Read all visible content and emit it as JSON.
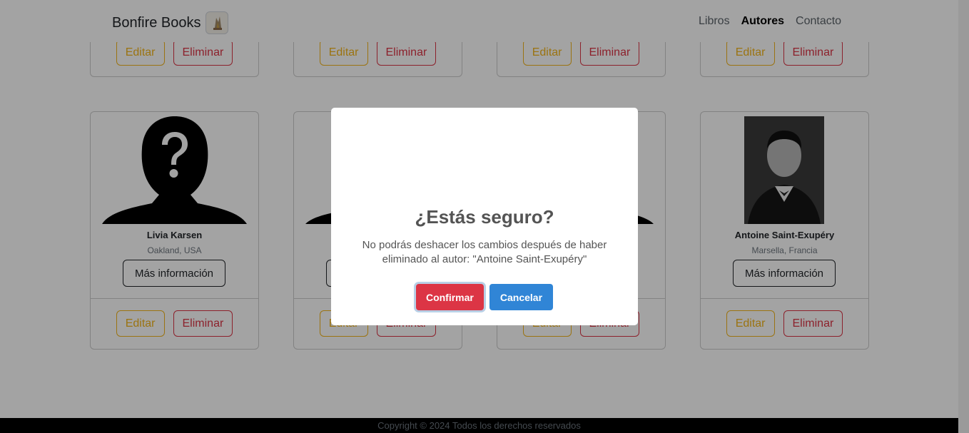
{
  "navbar": {
    "brand": "Bonfire Books",
    "links": [
      "Libros",
      "Autores",
      "Contacto"
    ],
    "active_link": "Autores"
  },
  "cards": {
    "edit_label": "Editar",
    "delete_label": "Eliminar",
    "more_info_label": "Más información",
    "authors": [
      {
        "name": "Livia Karsen",
        "place": "Oakland, USA"
      },
      {
        "name": "Antoine Saint-Exupéry",
        "place": "Marsella, Francia"
      }
    ]
  },
  "footer": {
    "text": "Copyright © 2024 Todos los derechos reservados"
  },
  "modal": {
    "title": "¿Estás seguro?",
    "text": "No podrás deshacer los cambios después de haber eliminado al autor: \"Antoine Saint-Exupéry\"",
    "confirm_label": "Confirmar",
    "cancel_label": "Cancelar"
  },
  "colors": {
    "edit": "#f2b51b",
    "delete": "#dc3545",
    "confirm": "#dc3545",
    "cancel": "#3085d6"
  }
}
